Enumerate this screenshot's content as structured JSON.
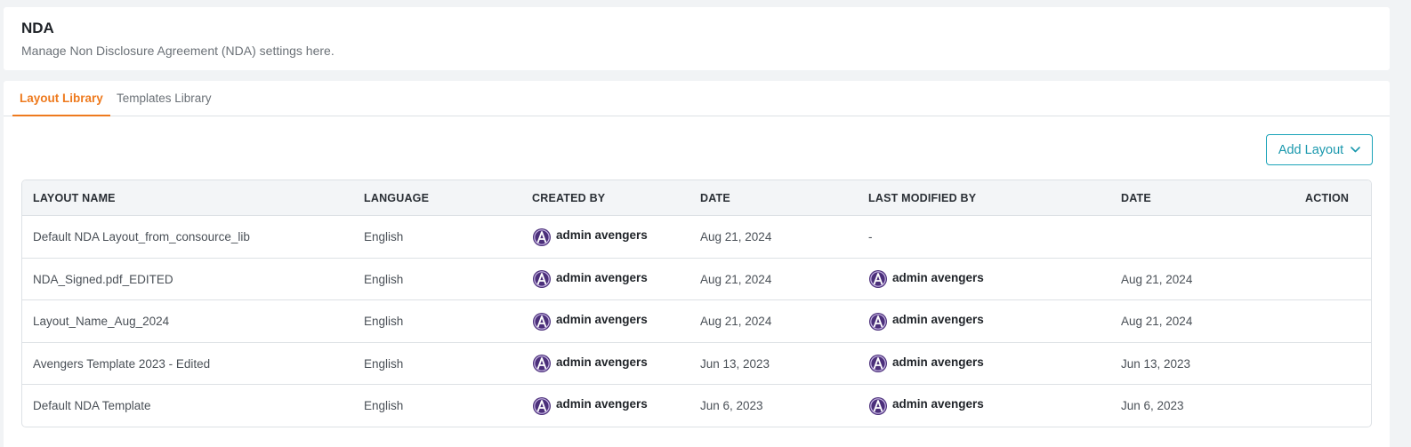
{
  "header": {
    "title": "NDA",
    "subtitle": "Manage Non Disclosure Agreement (NDA) settings here."
  },
  "tabs": [
    {
      "label": "Layout Library",
      "active": true
    },
    {
      "label": "Templates Library",
      "active": false
    }
  ],
  "add_button": {
    "label": "Add Layout",
    "icon": "chevron-down-icon"
  },
  "colors": {
    "accent_orange": "#ee7a1e",
    "accent_teal": "#1a98ad",
    "avatar_purple": "#5b3a8c"
  },
  "table": {
    "columns": [
      "LAYOUT NAME",
      "LANGUAGE",
      "CREATED BY",
      "DATE",
      "LAST MODIFIED BY",
      "DATE",
      "ACTION"
    ],
    "rows": [
      {
        "name": "Default NDA Layout_from_consource_lib",
        "language": "English",
        "created_by": "admin avengers",
        "created_date": "Aug 21, 2024",
        "modified_by": "-",
        "modified_date": ""
      },
      {
        "name": "NDA_Signed.pdf_EDITED",
        "language": "English",
        "created_by": "admin avengers",
        "created_date": "Aug 21, 2024",
        "modified_by": "admin avengers",
        "modified_date": "Aug 21, 2024"
      },
      {
        "name": "Layout_Name_Aug_2024",
        "language": "English",
        "created_by": "admin avengers",
        "created_date": "Aug 21, 2024",
        "modified_by": "admin avengers",
        "modified_date": "Aug 21, 2024"
      },
      {
        "name": "Avengers Template 2023 - Edited",
        "language": "English",
        "created_by": "admin avengers",
        "created_date": "Jun 13, 2023",
        "modified_by": "admin avengers",
        "modified_date": "Jun 13, 2023"
      },
      {
        "name": "Default NDA Template",
        "language": "English",
        "created_by": "admin avengers",
        "created_date": "Jun 6, 2023",
        "modified_by": "admin avengers",
        "modified_date": "Jun 6, 2023"
      }
    ]
  }
}
